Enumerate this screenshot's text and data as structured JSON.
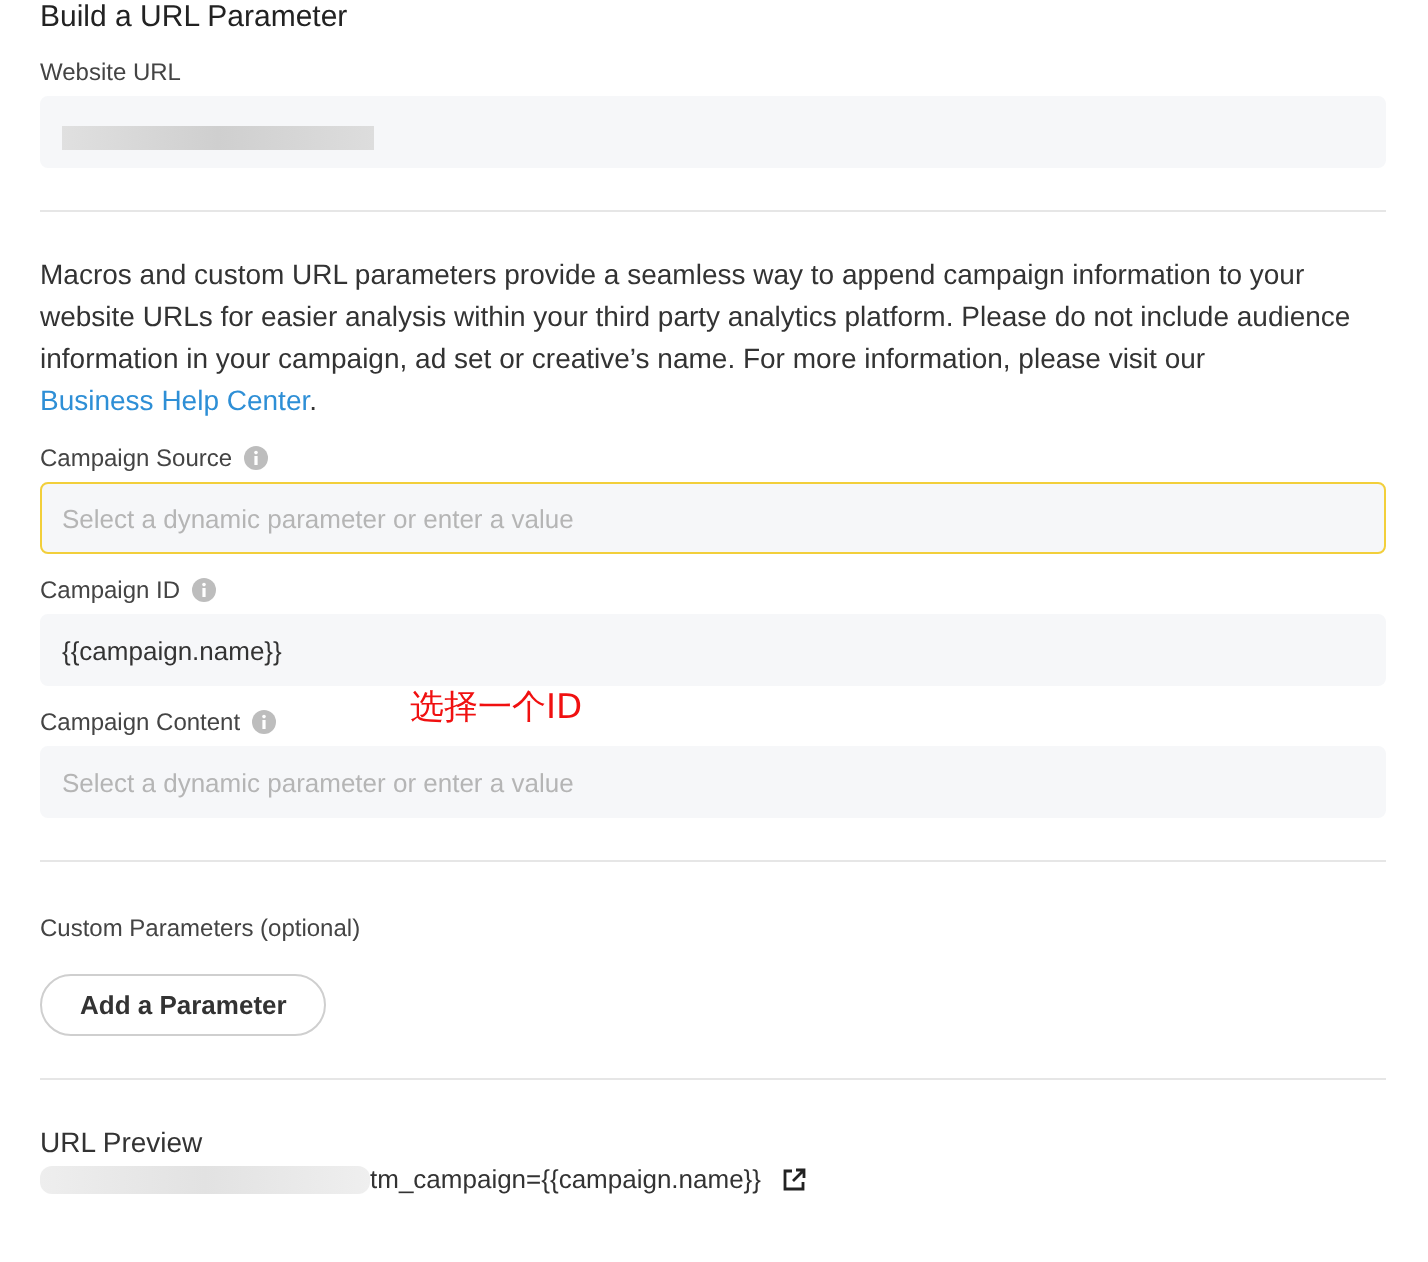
{
  "title": "Build a URL Parameter",
  "website_url": {
    "label": "Website URL"
  },
  "description": {
    "text": "Macros and custom URL parameters provide a seamless way to append campaign information to your website URLs for easier analysis within your third party analytics platform. Please do not include audience information in your campaign, ad set or creative’s name. For more information, please visit our ",
    "link": "Business Help Center",
    "end": "."
  },
  "fields": [
    {
      "label": "Campaign Source",
      "placeholder": "Select a dynamic parameter or enter a value",
      "focused": true
    },
    {
      "label": "Campaign ID",
      "value": "{{campaign.name}}",
      "focused": false
    },
    {
      "label": "Campaign Content",
      "placeholder": "Select a dynamic parameter or enter a value",
      "focused": false
    }
  ],
  "annotation": "选择一个ID",
  "custom_parameters": {
    "label": "Custom Parameters (optional)",
    "button": "Add a Parameter"
  },
  "url_preview": {
    "label": "URL Preview",
    "value": "tm_campaign={{campaign.name}}"
  }
}
